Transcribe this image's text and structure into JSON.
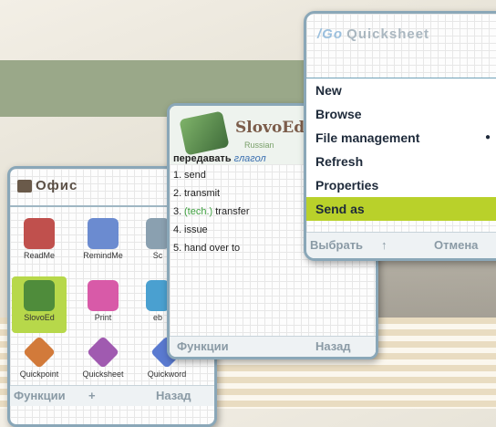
{
  "phone1": {
    "title": "Офис",
    "apps": [
      {
        "label": "ReadMe",
        "color": "#c0504d"
      },
      {
        "label": "RemindMe",
        "color": "#6b8bd0"
      },
      {
        "label": "Sc",
        "color": "#8aa0b0"
      },
      {
        "label": "SlovoEd",
        "color": "#4f8c3b"
      },
      {
        "label": "Print",
        "color": "#d85aa8"
      },
      {
        "label": "eb",
        "color": "#4aa0d0"
      },
      {
        "label": "Quickpoint",
        "color": "#d27a3a"
      },
      {
        "label": "Quicksheet",
        "color": "#a05ab0"
      },
      {
        "label": "Quickword",
        "color": "#5a7ad0"
      }
    ],
    "softkeys": {
      "left": "Функции",
      "middle": "+",
      "right": "Назад"
    }
  },
  "phone2": {
    "app_name": "SlovoEd",
    "subtitle": "Russian",
    "headword": "передавать",
    "headword_hint": "глагол",
    "translations": [
      {
        "n": "1.",
        "text": "send"
      },
      {
        "n": "2.",
        "text": "transmit"
      },
      {
        "n": "3.",
        "tag": "(tech.)",
        "text": "transfer"
      },
      {
        "n": "4.",
        "text": "issue"
      },
      {
        "n": "5.",
        "text": "hand over to"
      }
    ],
    "softkeys": {
      "left": "Функции",
      "right": "Назад"
    }
  },
  "phone3": {
    "title_prefix": "/Go",
    "title_app": "Quicksheet",
    "menu": [
      {
        "label": "New"
      },
      {
        "label": "Browse"
      },
      {
        "label": "File management",
        "submenu": true
      },
      {
        "label": "Refresh"
      },
      {
        "label": "Properties"
      },
      {
        "label": "Send as",
        "selected": true
      }
    ],
    "softkeys": {
      "left": "Выбрать",
      "middle": "↑",
      "right": "Отмена"
    }
  }
}
